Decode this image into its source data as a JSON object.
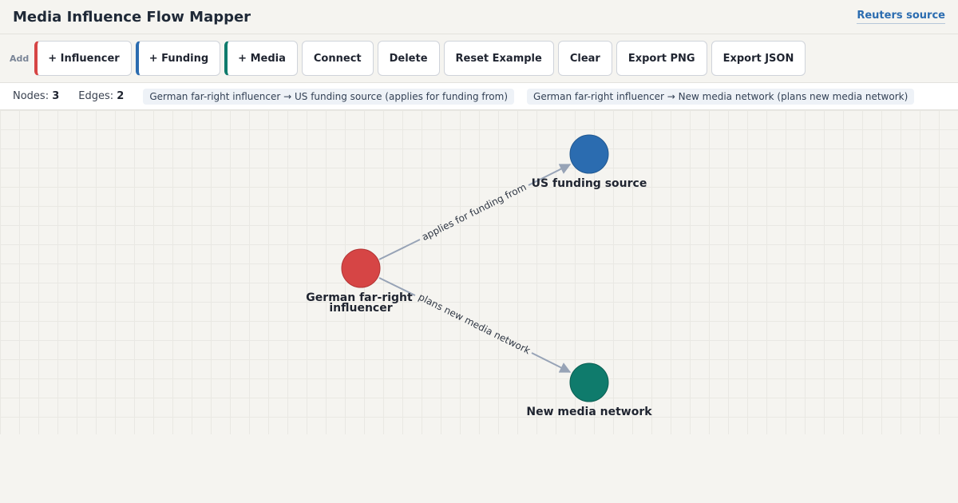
{
  "header": {
    "title": "Media Influence Flow Mapper",
    "source_link": "Reuters source"
  },
  "toolbar": {
    "add_label": "Add",
    "buttons": {
      "add_influencer": "+ Influencer",
      "add_funding": "+ Funding",
      "add_media": "+ Media",
      "connect": "Connect",
      "delete": "Delete",
      "reset_example": "Reset Example",
      "clear": "Clear",
      "export_png": "Export PNG",
      "export_json": "Export JSON"
    }
  },
  "status": {
    "nodes_label": "Nodes:",
    "nodes_count": "3",
    "edges_label": "Edges:",
    "edges_count": "2",
    "edge_summaries": [
      "German far-right influencer → US funding source (applies for funding from)",
      "German far-right influencer → New media network (plans new media network)"
    ]
  },
  "colors": {
    "influencer": "#d64545",
    "funding": "#2b6cb0",
    "media": "#0f7b6c",
    "edge": "#97a3b6"
  },
  "graph": {
    "nodes": [
      {
        "id": "influencer",
        "type": "influencer",
        "label_lines": [
          "German far-right",
          "influencer"
        ]
      },
      {
        "id": "funding",
        "type": "funding",
        "label_lines": [
          "US funding source"
        ]
      },
      {
        "id": "media",
        "type": "media",
        "label_lines": [
          "New media network"
        ]
      }
    ],
    "edges": [
      {
        "from": "influencer",
        "to": "funding",
        "label": "applies for funding from"
      },
      {
        "from": "influencer",
        "to": "media",
        "label": "plans new media network"
      }
    ]
  }
}
